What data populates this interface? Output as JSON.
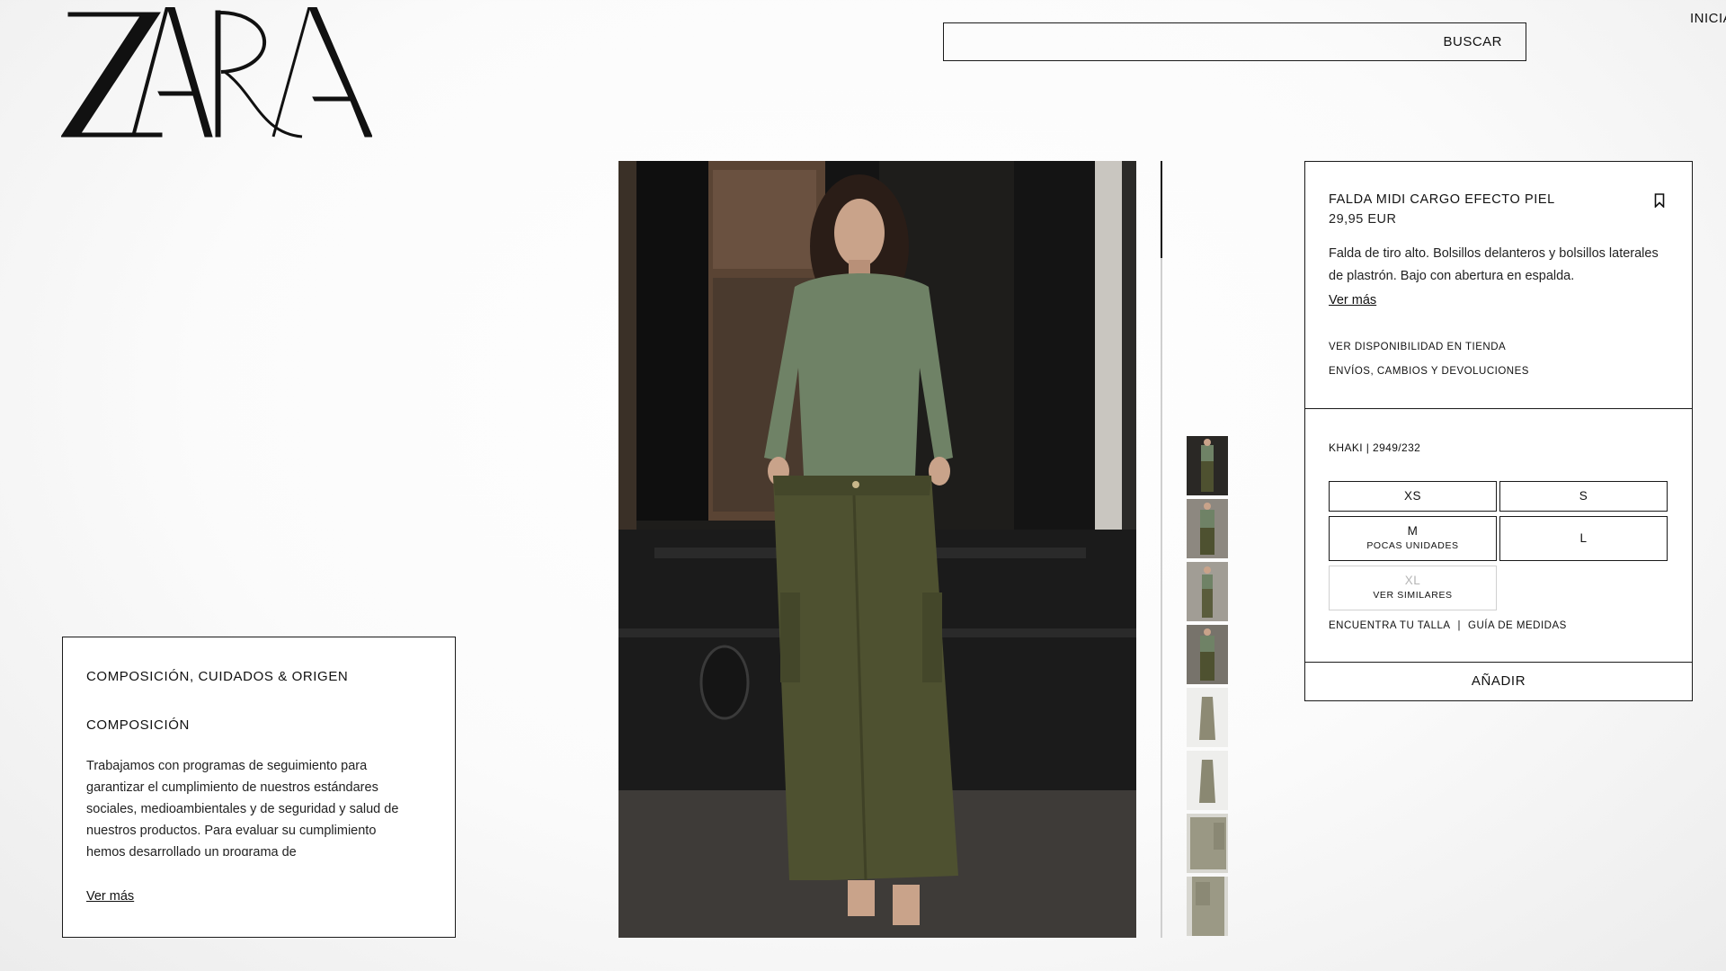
{
  "brand": {
    "logo_text": "ZARA"
  },
  "header": {
    "search_placeholder": "",
    "search_button": "BUSCAR",
    "login_link": "INICIA"
  },
  "care": {
    "title": "COMPOSICIÓN, CUIDADOS & ORIGEN",
    "subtitle": "COMPOSICIÓN",
    "text": "Trabajamos con programas de seguimiento para garantizar el cumplimiento de nuestros estándares sociales, medioambientales y de seguridad y salud de nuestros productos. Para evaluar su cumplimiento hemos desarrollado un programa de",
    "more": "Ver más"
  },
  "gallery": {
    "thumb_count": 8,
    "selected_index": 0,
    "icons": [
      "product-photo",
      "bookmark-icon"
    ]
  },
  "product": {
    "name": "FALDA MIDI CARGO EFECTO PIEL",
    "price": "29,95 EUR",
    "description": "Falda de tiro alto. Bolsillos delanteros y bolsillos laterales de plastrón. Bajo con abertura en espalda.",
    "more": "Ver más",
    "store_availability": "VER DISPONIBILIDAD EN TIENDA",
    "shipping": "ENVÍOS, CAMBIOS Y DEVOLUCIONES",
    "color_ref": "KHAKI | 2949/232",
    "sizes": [
      {
        "label": "XS",
        "note": ""
      },
      {
        "label": "S",
        "note": ""
      },
      {
        "label": "M",
        "note": "POCAS UNIDADES"
      },
      {
        "label": "L",
        "note": ""
      },
      {
        "label": "XL",
        "note": "VER SIMILARES"
      }
    ],
    "find_size": "ENCUENTRA TU TALLA",
    "separator": "|",
    "size_guide": "GUÍA DE MEDIDAS",
    "add_button": "AÑADIR"
  },
  "colors": {
    "text": "#111111",
    "skirt": "#4e5130",
    "sweater": "#6f8266",
    "disabled": "#b5b5b5"
  }
}
